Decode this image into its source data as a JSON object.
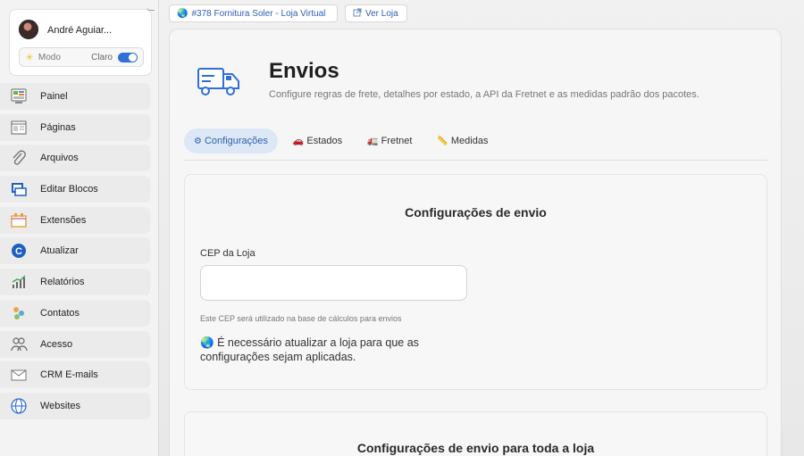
{
  "user": {
    "name": "André Aguiar...",
    "mode_label": "Modo",
    "mode_state": "Claro"
  },
  "nav": [
    {
      "label": "Painel",
      "icon": "dashboard-icon"
    },
    {
      "label": "Páginas",
      "icon": "pages-icon"
    },
    {
      "label": "Arquivos",
      "icon": "paperclip-icon"
    },
    {
      "label": "Editar Blocos",
      "icon": "blocks-icon"
    },
    {
      "label": "Extensões",
      "icon": "extensions-icon"
    },
    {
      "label": "Atualizar",
      "icon": "update-icon"
    },
    {
      "label": "Relatórios",
      "icon": "reports-icon"
    },
    {
      "label": "Contatos",
      "icon": "contacts-icon"
    },
    {
      "label": "Acesso",
      "icon": "access-icon"
    },
    {
      "label": "CRM E-mails",
      "icon": "mail-icon"
    },
    {
      "label": "Websites",
      "icon": "globe-icon"
    }
  ],
  "top": {
    "store_tag": "#378 Fornitura Soler - Loja Virtual",
    "view_store": "Ver Loja"
  },
  "header": {
    "title": "Envios",
    "subtitle": "Configure regras de frete, detalhes por estado, a API da Fretnet e as medidas padrão dos pacotes."
  },
  "tabs": [
    {
      "label": "Configurações",
      "emoji": "⚙",
      "active": true
    },
    {
      "label": "Estados",
      "emoji": "🚗",
      "active": false
    },
    {
      "label": "Fretnet",
      "emoji": "🚛",
      "active": false
    },
    {
      "label": "Medidas",
      "emoji": "📏",
      "active": false
    }
  ],
  "settings": {
    "title": "Configurações de envio",
    "cep_label": "CEP da Loja",
    "cep_value": "",
    "cep_hint": "Este CEP será utilizado na base de cálculos para envios",
    "notice": "É necessário atualizar a loja para que as configurações sejam aplicadas."
  },
  "store_settings": {
    "title": "Configurações de envio para toda a loja"
  },
  "colors": {
    "accent": "#2f6fd6",
    "tab_active_bg": "#dde8f6",
    "link": "#2f5fb3"
  }
}
